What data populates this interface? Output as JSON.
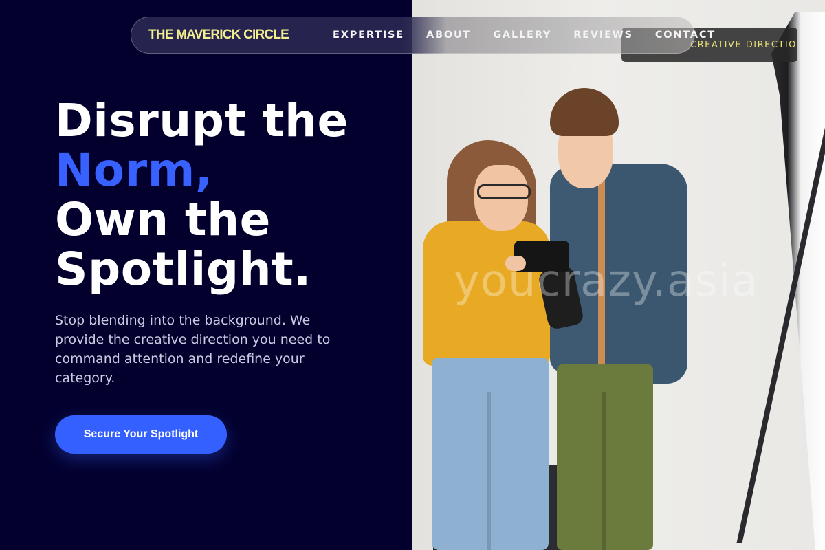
{
  "nav": {
    "brand": "THE MAVERICK CIRCLE",
    "links": [
      "EXPERTISE",
      "ABOUT",
      "GALLERY",
      "REVIEWS",
      "CONTACT"
    ]
  },
  "badge": {
    "text": "CREATIVE DIRECTION"
  },
  "hero": {
    "line1": "Disrupt the",
    "line2": "Norm,",
    "line3": "Own the",
    "line4": "Spotlight.",
    "subtitle": "Stop blending into the background. We provide the creative direction you need to command attention and redefine your category.",
    "cta_label": "Secure Your Spotlight"
  },
  "image": {
    "watermark": "youcrazy.asia"
  },
  "colors": {
    "background": "#03002e",
    "accent": "#3862ff",
    "brand": "#f3ef8f",
    "cta": "#3460ff"
  }
}
